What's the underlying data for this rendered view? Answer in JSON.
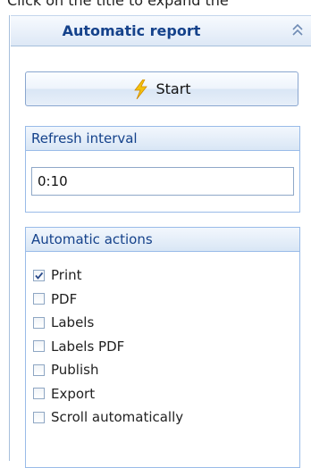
{
  "hint": {
    "text": "Click on the title to expand the"
  },
  "panel": {
    "title": "Automatic report",
    "collapse_icon": "double-chevron-up-icon"
  },
  "start_button": {
    "label": "Start",
    "icon": "lightning-bolt-icon"
  },
  "refresh": {
    "header": "Refresh interval",
    "value": "0:10"
  },
  "actions": {
    "header": "Automatic actions",
    "items": [
      {
        "label": "Print",
        "checked": true
      },
      {
        "label": "PDF",
        "checked": false
      },
      {
        "label": "Labels",
        "checked": false
      },
      {
        "label": "Labels PDF",
        "checked": false
      },
      {
        "label": "Publish",
        "checked": false
      },
      {
        "label": "Export",
        "checked": false
      },
      {
        "label": "Scroll automatically",
        "checked": false
      }
    ]
  },
  "colors": {
    "accent": "#15428b",
    "border": "#99bbe8",
    "bolt": "#f4c20d"
  }
}
